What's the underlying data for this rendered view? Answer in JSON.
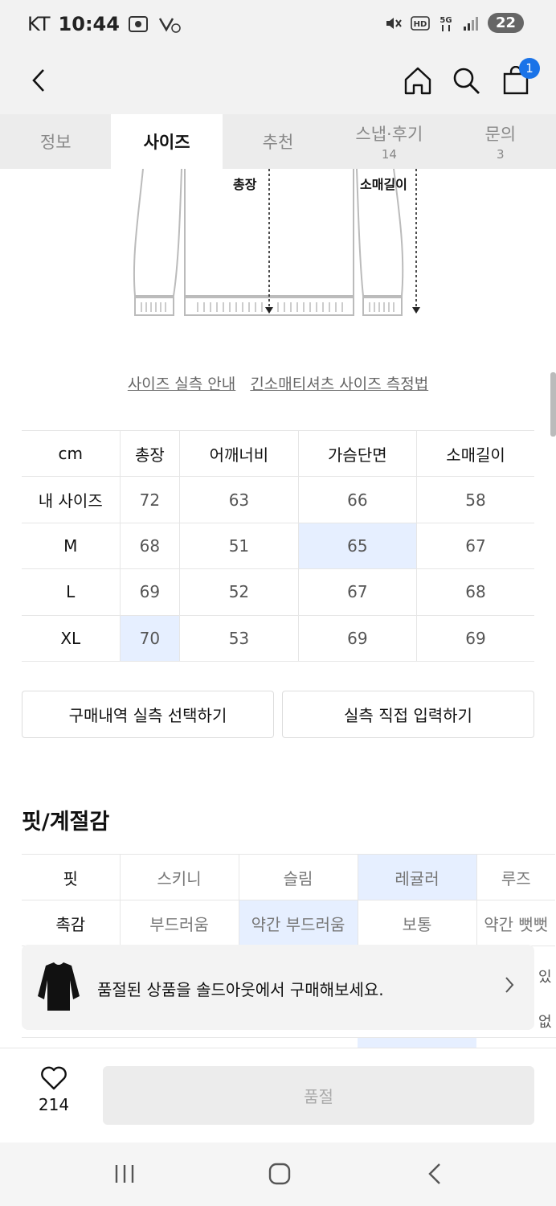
{
  "status": {
    "carrier": "KT",
    "time": "10:44",
    "battery": "22"
  },
  "tabs": [
    {
      "label": "정보",
      "count": ""
    },
    {
      "label": "사이즈",
      "count": ""
    },
    {
      "label": "추천",
      "count": ""
    },
    {
      "label": "스냅·후기",
      "count": "14"
    },
    {
      "label": "문의",
      "count": "3"
    }
  ],
  "header": {
    "cart_count": "1"
  },
  "illustration": {
    "label_length": "총장",
    "label_sleeve": "소매길이"
  },
  "guide": {
    "link1": "사이즈 실측 안내",
    "link2": "긴소매티셔츠 사이즈 측정법"
  },
  "size_table": {
    "header": [
      "cm",
      "총장",
      "어깨너비",
      "가슴단면",
      "소매길이"
    ],
    "rows": [
      [
        "내 사이즈",
        "72",
        "63",
        "66",
        "58"
      ],
      [
        "M",
        "68",
        "51",
        "65",
        "67"
      ],
      [
        "L",
        "69",
        "52",
        "67",
        "68"
      ],
      [
        "XL",
        "70",
        "53",
        "69",
        "69"
      ]
    ]
  },
  "buttons": {
    "purchase_history": "구매내역 실측 선택하기",
    "manual_input": "실측 직접 입력하기"
  },
  "fit": {
    "title": "핏/계절감",
    "rows": [
      [
        "핏",
        "스키니",
        "슬림",
        "레귤러",
        "루즈"
      ],
      [
        "촉감",
        "부드러움",
        "약간 부드러움",
        "보통",
        "약간 뻣뻣"
      ]
    ],
    "peek": [
      "있",
      "없"
    ]
  },
  "banner": {
    "text": "품절된 상품을 솔드아웃에서 구매해보세요."
  },
  "bottom": {
    "like_count": "214",
    "buy_label": "품절"
  },
  "colors": {
    "accent": "#1a73e8",
    "highlight": "#e6efff"
  }
}
